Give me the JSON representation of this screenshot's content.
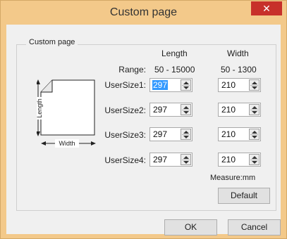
{
  "window": {
    "title": "Custom page",
    "close_glyph": "✕"
  },
  "group": {
    "label": "Custom page"
  },
  "headers": {
    "length": "Length",
    "width": "Width"
  },
  "range": {
    "label": "Range:",
    "length": "50 - 15000",
    "width": "50 - 1300"
  },
  "rows": [
    {
      "label": "UserSize1:",
      "length": "297",
      "width": "210"
    },
    {
      "label": "UserSize2:",
      "length": "297",
      "width": "210"
    },
    {
      "label": "UserSize3:",
      "length": "297",
      "width": "210"
    },
    {
      "label": "UserSize4:",
      "length": "297",
      "width": "210"
    }
  ],
  "illustration": {
    "length_label": "Length",
    "width_label": "Width"
  },
  "measure": "Measure:mm",
  "buttons": {
    "default": "Default",
    "ok": "OK",
    "cancel": "Cancel"
  }
}
